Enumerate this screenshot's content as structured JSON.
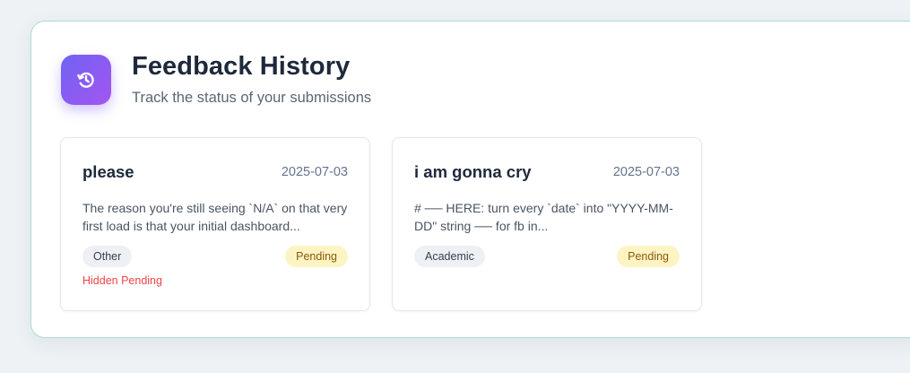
{
  "header": {
    "icon": "history-icon",
    "title": "Feedback History",
    "subtitle": "Track the status of your submissions"
  },
  "colors": {
    "accent_gradient_start": "#6f63f3",
    "accent_gradient_end": "#a455f1",
    "panel_border": "#a9dcd8",
    "pending_bg": "#fdf4c4",
    "pending_text": "#8a5a08",
    "hidden_text": "#ef4444"
  },
  "feedback": [
    {
      "title": "please",
      "date": "2025-07-03",
      "body": "The reason you're still seeing `N/A` on that very first load is that your initial dashboard...",
      "category": "Other",
      "status": "Pending",
      "note": "Hidden Pending"
    },
    {
      "title": "i am gonna cry",
      "date": "2025-07-03",
      "body": "# ── HERE: turn every `date` into \"YYYY-MM-DD\" string ── for fb in...",
      "category": "Academic",
      "status": "Pending"
    }
  ]
}
